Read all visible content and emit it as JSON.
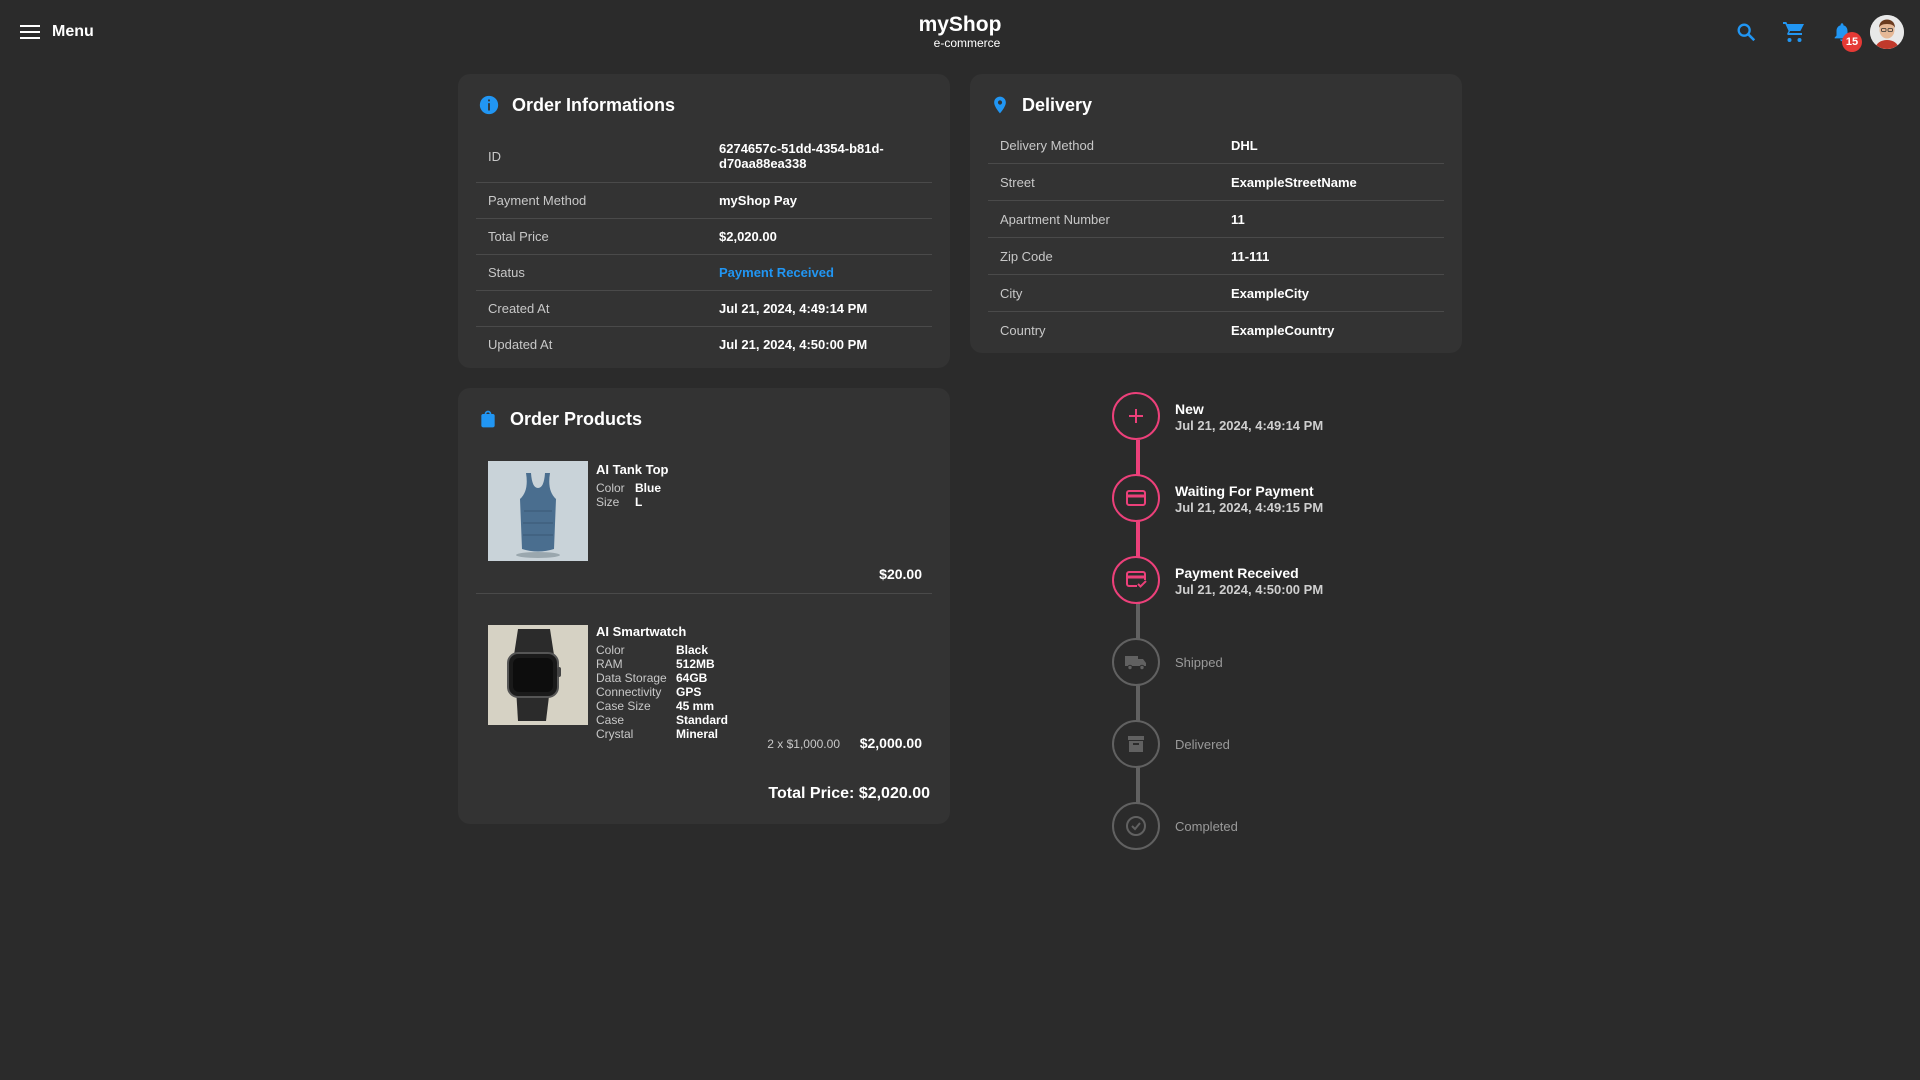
{
  "header": {
    "menu_label": "Menu",
    "brand_name": "myShop",
    "brand_sub": "e-commerce",
    "notification_count": "15",
    "accent_color": "#2196f3"
  },
  "order_info": {
    "title": "Order Informations",
    "rows": [
      {
        "label": "ID",
        "value": "6274657c-51dd-4354-b81d-d70aa88ea338"
      },
      {
        "label": "Payment Method",
        "value": "myShop Pay"
      },
      {
        "label": "Total Price",
        "value": "$2,020.00"
      },
      {
        "label": "Status",
        "value": "Payment Received"
      },
      {
        "label": "Created At",
        "value": "Jul 21, 2024, 4:49:14 PM"
      },
      {
        "label": "Updated At",
        "value": "Jul 21, 2024, 4:50:00 PM"
      }
    ]
  },
  "delivery": {
    "title": "Delivery",
    "rows": [
      {
        "label": "Delivery Method",
        "value": "DHL"
      },
      {
        "label": "Street",
        "value": "ExampleStreetName"
      },
      {
        "label": "Apartment Number",
        "value": "11"
      },
      {
        "label": "Zip Code",
        "value": "11-111"
      },
      {
        "label": "City",
        "value": "ExampleCity"
      },
      {
        "label": "Country",
        "value": "ExampleCountry"
      }
    ]
  },
  "order_products": {
    "title": "Order Products",
    "products": [
      {
        "name": "AI Tank Top",
        "attributes": [
          {
            "key": "Color",
            "value": "Blue"
          },
          {
            "key": "Size",
            "value": "L"
          }
        ],
        "price": "$20.00",
        "image_icon": "tank-top-image"
      },
      {
        "name": "AI Smartwatch",
        "attributes": [
          {
            "key": "Color",
            "value": "Black"
          },
          {
            "key": "RAM",
            "value": "512MB"
          },
          {
            "key": "Data Storage",
            "value": "64GB"
          },
          {
            "key": "Connectivity",
            "value": "GPS"
          },
          {
            "key": "Case Size",
            "value": "45 mm"
          },
          {
            "key": "Case",
            "value": "Standard"
          },
          {
            "key": "Crystal",
            "value": "Mineral"
          }
        ],
        "quantity_text": "2 x $1,000.00",
        "price": "$2,000.00",
        "image_icon": "smartwatch-image"
      }
    ],
    "total": "Total Price: $2,020.00"
  },
  "timeline": {
    "active_color": "#ec407a",
    "inactive_color": "#616161",
    "steps": [
      {
        "title": "New",
        "date": "Jul 21, 2024, 4:49:14 PM",
        "icon": "plus-icon"
      },
      {
        "title": "Waiting For Payment",
        "date": "Jul 21, 2024, 4:49:15 PM",
        "icon": "credit-card-icon"
      },
      {
        "title": "Payment Received",
        "date": "Jul 21, 2024, 4:50:00 PM",
        "icon": "card-check-icon"
      },
      {
        "title": "Shipped",
        "date": "",
        "icon": "truck-icon"
      },
      {
        "title": "Delivered",
        "date": "",
        "icon": "archive-icon"
      },
      {
        "title": "Completed",
        "date": "",
        "icon": "check-circle-icon"
      }
    ]
  }
}
